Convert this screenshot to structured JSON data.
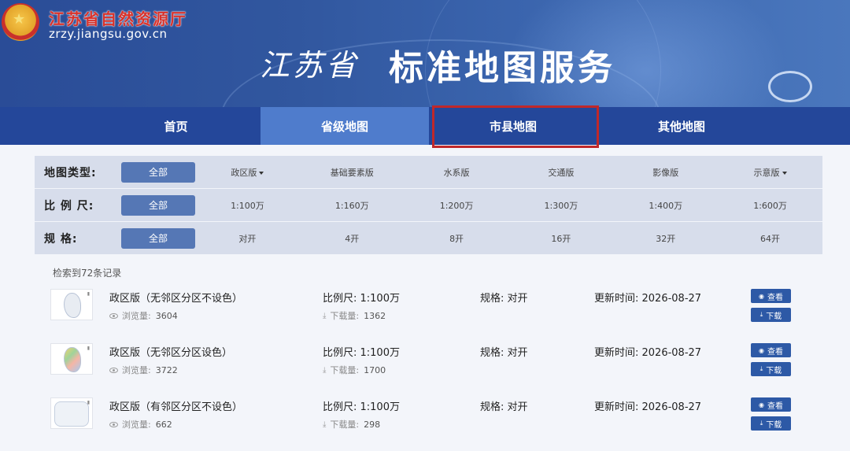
{
  "header": {
    "site_name": "江苏省自然资源厅",
    "site_url": "zrzy.jiangsu.gov.cn",
    "title_province": "江苏省",
    "title_service": "标准地图服务",
    "emblem_icon": "national-emblem-icon"
  },
  "nav": {
    "items": [
      {
        "label": "首页"
      },
      {
        "label": "省级地图"
      },
      {
        "label": "市县地图"
      },
      {
        "label": "其他地图"
      }
    ],
    "active_color": "#4f7ccc",
    "highlight_color": "#c0282a"
  },
  "filters": {
    "all_label": "全部",
    "type": {
      "label": "地图类型:",
      "options": [
        "政区版",
        "基础要素版",
        "水系版",
        "交通版",
        "影像版",
        "示意版"
      ]
    },
    "scale": {
      "label": "比 例 尺:",
      "options": [
        "1:100万",
        "1:160万",
        "1:200万",
        "1:300万",
        "1:400万",
        "1:600万"
      ]
    },
    "size": {
      "label": "规 格:",
      "options": [
        "对开",
        "4开",
        "8开",
        "16开",
        "32开",
        "64开"
      ]
    }
  },
  "results": {
    "count_text": "检索到72条记录",
    "views_label": "浏览量:",
    "downloads_label": "下载量:",
    "view_button": "查看",
    "download_button": "下载",
    "items": [
      {
        "title": "政区版（无邻区分区不设色）",
        "views": "3604",
        "scale": "比例尺:  1:100万",
        "downloads": "1362",
        "size": "规格:  对开",
        "updated": "更新时间:  2026-08-27"
      },
      {
        "title": "政区版（无邻区分区设色）",
        "views": "3722",
        "scale": "比例尺:  1:100万",
        "downloads": "1700",
        "size": "规格:  对开",
        "updated": "更新时间:  2026-08-27"
      },
      {
        "title": "政区版（有邻区分区不设色）",
        "views": "662",
        "scale": "比例尺:  1:100万",
        "downloads": "298",
        "size": "规格:  对开",
        "updated": "更新时间:  2026-08-27"
      }
    ]
  }
}
